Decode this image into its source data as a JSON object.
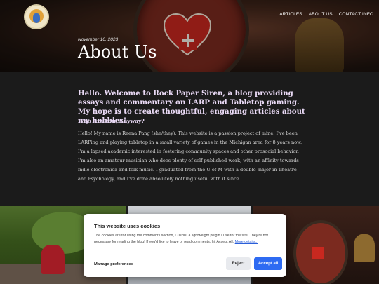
{
  "nav": {
    "items": [
      "ARTICLES",
      "ABOUT US",
      "CONTACT INFO"
    ]
  },
  "post": {
    "date": "November 10, 2023",
    "title": "About Us"
  },
  "content": {
    "intro": "Hello. Welcome to Rock Paper Siren, a blog providing essays and commentary on LARP and Tabletop gaming. My hope is to create thoughtful, engaging articles about my hobbies!",
    "subheading": "Who Are You, Anyway?",
    "body": "Hello! My name is Reena Pang (she/they). This website is a passion project of mine. I've been LARPing and playing tabletop in a small variety of games in the Michigan area for 8 years now. I'm a lapsed academic interested in fostering community spaces and other prosocial behavior. I'm also an amateur musician who does plenty of self-published work, with an affinity towards indie electronica and folk music. I graduated from the U of M with a double major in Theatre and Psychology, and I've done absolutely nothing useful with it since."
  },
  "cookie": {
    "title": "This website uses cookies",
    "text": "The cookies are for using the comments section, Cusdis, a lightweight plugin I use for the site. They're not necessary for reading the blog! If you'd like to leave or read comments, hit Accept All.",
    "more_link": "More details...",
    "manage_label": "Manage preferences",
    "reject_label": "Reject",
    "accept_label": "Accept all"
  },
  "icons": {
    "logo": "site-logo-icon"
  }
}
